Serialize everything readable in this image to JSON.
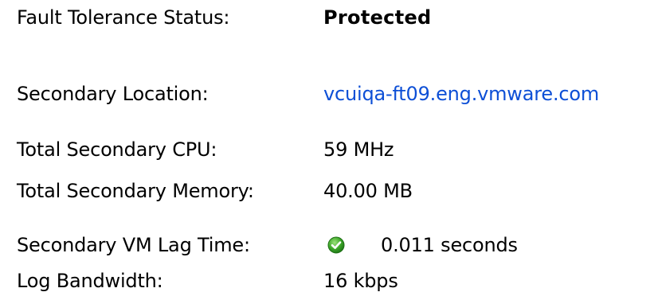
{
  "ft_summary": {
    "status": {
      "label": "Fault Tolerance Status:",
      "value": "Protected"
    },
    "location": {
      "label": "Secondary Location:",
      "value": "vcuiqa-ft09.eng.vmware.com"
    },
    "cpu": {
      "label": "Total Secondary CPU:",
      "value": "59 MHz"
    },
    "memory": {
      "label": "Total Secondary Memory:",
      "value": "40.00 MB"
    },
    "lag": {
      "label": "Secondary VM Lag Time:",
      "value": "0.011 seconds",
      "icon": "check-ok-icon",
      "icon_color": "#3fa82a"
    },
    "bandwidth": {
      "label": "Log Bandwidth:",
      "value": "16 kbps"
    }
  },
  "colors": {
    "link": "#0d4fd6",
    "text": "#000000",
    "background": "#ffffff"
  }
}
